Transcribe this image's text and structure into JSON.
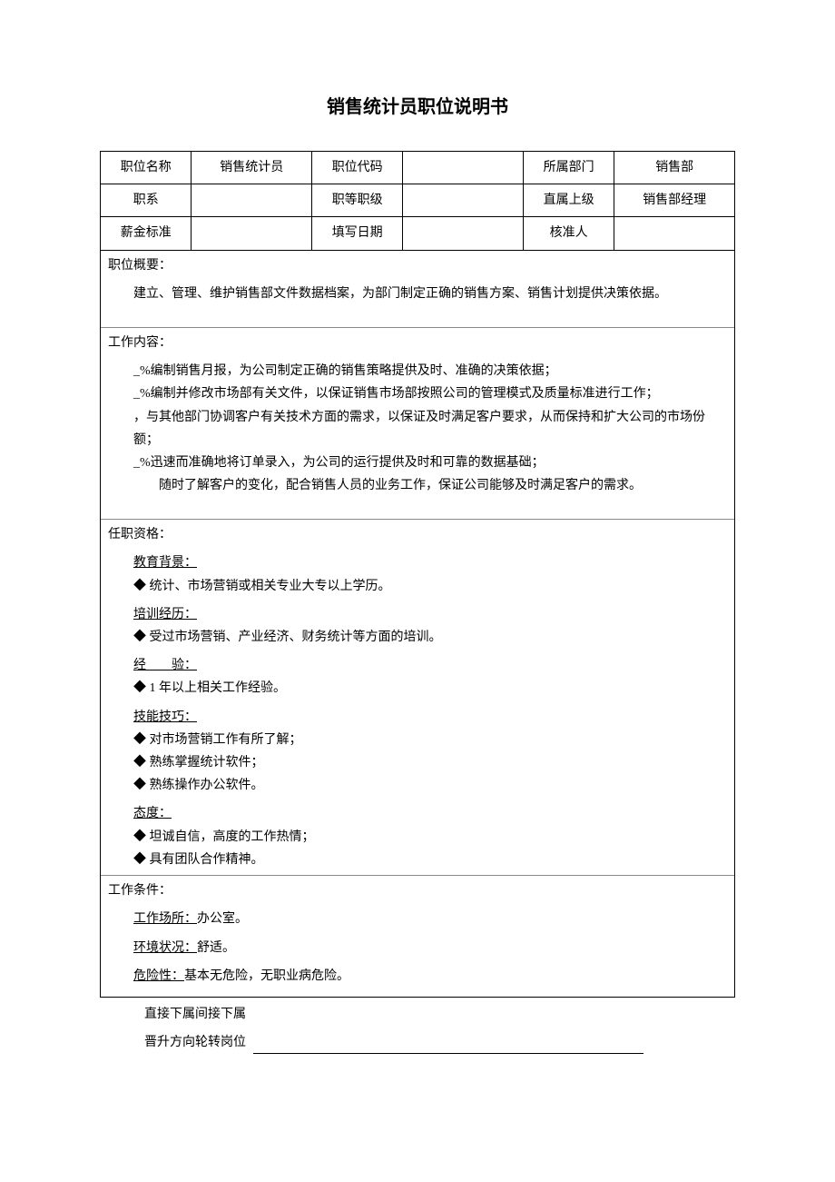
{
  "title": "销售统计员职位说明书",
  "header": {
    "labels": {
      "positionName": "职位名称",
      "positionCode": "职位代码",
      "department": "所属部门",
      "jobFamily": "职系",
      "gradeLevel": "职等职级",
      "directSupervisor": "直属上级",
      "salaryStandard": "薪金标准",
      "fillDate": "填写日期",
      "approver": "核准人"
    },
    "values": {
      "positionName": "销售统计员",
      "positionCode": "",
      "department": "销售部",
      "jobFamily": "",
      "gradeLevel": "",
      "directSupervisor": "销售部经理",
      "salaryStandard": "",
      "fillDate": "",
      "approver": ""
    }
  },
  "sections": {
    "overview": {
      "title": "职位概要：",
      "text": "建立、管理、维护销售部文件数据档案，为部门制定正确的销售方案、销售计划提供决策依据。"
    },
    "content": {
      "title": "工作内容：",
      "items": [
        "_%编制销售月报，为公司制定正确的销售策略提供及时、准确的决策依据；",
        "_%编制并修改市场部有关文件，以保证销售市场部按照公司的管理模式及质量标准进行工作；",
        "，与其他部门协调客户有关技术方面的需求，以保证及时满足客户要求，从而保持和扩大公司的市场份额；",
        "_%迅速而准确地将订单录入，为公司的运行提供及时和可靠的数据基础；"
      ],
      "extra": "随时了解客户的变化，配合销售人员的业务工作，保证公司能够及时满足客户的需求。"
    },
    "qualification": {
      "title": "任职资格：",
      "education": {
        "head": "教育背景：",
        "items": [
          "◆ 统计、市场营销或相关专业大专以上学历。"
        ]
      },
      "training": {
        "head": "培训经历：",
        "items": [
          "◆ 受过市场营销、产业经济、财务统计等方面的培训。"
        ]
      },
      "experience": {
        "head": "经　　验：",
        "items": [
          "◆ 1 年以上相关工作经验。"
        ]
      },
      "skills": {
        "head": "技能技巧：",
        "items": [
          "◆ 对市场营销工作有所了解；",
          "◆ 熟练掌握统计软件；",
          "◆ 熟练操作办公软件。"
        ]
      },
      "attitude": {
        "head": "态度：",
        "items": [
          "◆ 坦诚自信，高度的工作热情；",
          "◆ 具有团队合作精神。"
        ]
      }
    },
    "conditions": {
      "title": "工作条件：",
      "rows": [
        {
          "label": "工作场所：",
          "value": "办公室。"
        },
        {
          "label": "环境状况：",
          "value": "舒适。"
        },
        {
          "label": "危险性：",
          "value": "基本无危险，无职业病危险。"
        }
      ]
    },
    "footer": {
      "line1a": "直接下属",
      "line1b": "间接下属",
      "line2a": "晋升方向",
      "line2b": "轮转岗位"
    }
  }
}
